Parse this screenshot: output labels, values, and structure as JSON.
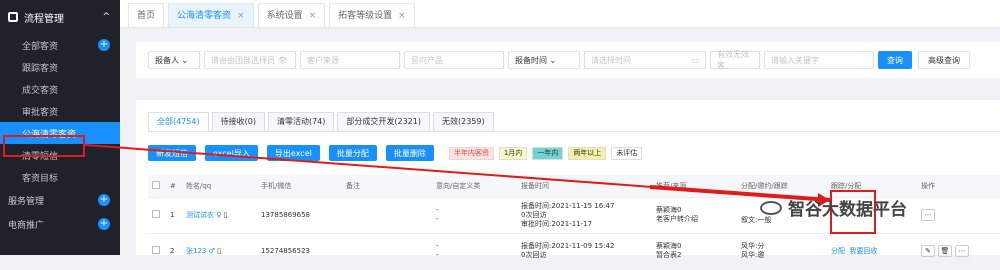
{
  "sidebar": {
    "header": "流程管理",
    "items": [
      "全部客资",
      "跟踪客资",
      "成交客资",
      "审批客资",
      "公海清零客资",
      "清零短信",
      "客资目标"
    ],
    "groups": [
      "服务管理",
      "电商推广"
    ]
  },
  "tabs": [
    "首页",
    "公海清零客资",
    "系统设置",
    "拓客等级设置"
  ],
  "filter": {
    "owner": "报备人",
    "source_placeholder": "请由由团部选择员",
    "client_source": "客户来源",
    "product": "意向产品",
    "time_label": "报备时间",
    "date_placeholder": "请选择时间",
    "status": "有效无效客",
    "keyword_placeholder": "请输入关键字",
    "query": "查询",
    "advanced": "高级查询"
  },
  "subtabs": [
    "全部(4754)",
    "待接收(0)",
    "清零活动(74)",
    "部分成交开发(2321)",
    "无效(2359)"
  ],
  "actions": [
    "新发短信",
    "excel导入",
    "导出excel",
    "批量分配",
    "批量删除"
  ],
  "legend": [
    "半年内客资",
    "1月内",
    "一年内",
    "两年以上",
    "未评估"
  ],
  "table": {
    "headers": [
      "#",
      "姓名/qq",
      "手机/微信",
      "备注",
      "意向/自定义类",
      "报备时间",
      "推荐/来源",
      "分配/邀约/跟踪",
      "跟踪/分配",
      "操作"
    ],
    "rows": [
      {
        "index": "1",
        "name": "测试试衣",
        "phone": "13785869658",
        "intent": "-",
        "intent2": "-",
        "time1": "报备时间:2021-11-15 16:47",
        "time2": "0次回访",
        "time3": "审批时间:2021-11-17",
        "ref1": "蔡颖海0",
        "ref2": "老客户转介绍",
        "alloc": "叙文:一般"
      },
      {
        "index": "2",
        "name": "张123",
        "phone": "15274856523",
        "intent": "-",
        "intent2": "-",
        "time1": "报备时间:2021-11-09 15:42",
        "time2": "0次回访",
        "time3": "",
        "ref1": "蔡颖海0",
        "ref2": "暂合表2",
        "alloc": "风华:分",
        "alloc2": "风华:邀",
        "assign": "分配",
        "recycle": "我要回收"
      }
    ]
  },
  "watermark": "智谷大数据平台",
  "colors": {
    "accent": "#1890ff",
    "sidebar": "#20222a",
    "annotation": "#e01b1b"
  }
}
